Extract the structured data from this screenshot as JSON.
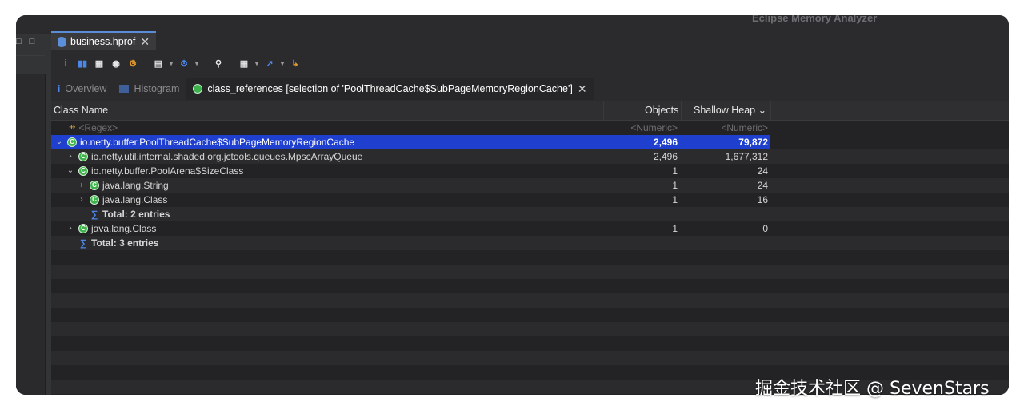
{
  "window": {
    "app_title": "Eclipse Memory Analyzer"
  },
  "editor_tab": {
    "label": "business.hprof",
    "icon": "database-icon"
  },
  "subtabs": [
    {
      "label": "Overview",
      "icon": "info-icon"
    },
    {
      "label": "Histogram",
      "icon": "histogram-icon"
    },
    {
      "label": "class_references [selection of 'PoolThreadCache$SubPageMemoryRegionCache']",
      "icon": "references-icon"
    }
  ],
  "table": {
    "headers": {
      "class_name": "Class Name",
      "objects": "Objects",
      "shallow_heap": "Shallow Heap ⌄"
    },
    "filter": {
      "class_name": "<Regex>",
      "objects": "<Numeric>",
      "shallow_heap": "<Numeric>"
    },
    "rows": [
      {
        "name": "io.netty.buffer.PoolThreadCache$SubPageMemoryRegionCache",
        "objects": "2,496",
        "shallow": "79,872"
      },
      {
        "name": "io.netty.util.internal.shaded.org.jctools.queues.MpscArrayQueue",
        "objects": "2,496",
        "shallow": "1,677,312"
      },
      {
        "name": "io.netty.buffer.PoolArena$SizeClass",
        "objects": "1",
        "shallow": "24"
      },
      {
        "name": "java.lang.String",
        "objects": "1",
        "shallow": "24"
      },
      {
        "name": "java.lang.Class",
        "objects": "1",
        "shallow": "16"
      },
      {
        "name": "Total: 2 entries"
      },
      {
        "name": "java.lang.Class",
        "objects": "1",
        "shallow": "0"
      },
      {
        "name": "Total: 3 entries"
      }
    ]
  },
  "watermark": "掘金技术社区 @ SevenStars"
}
